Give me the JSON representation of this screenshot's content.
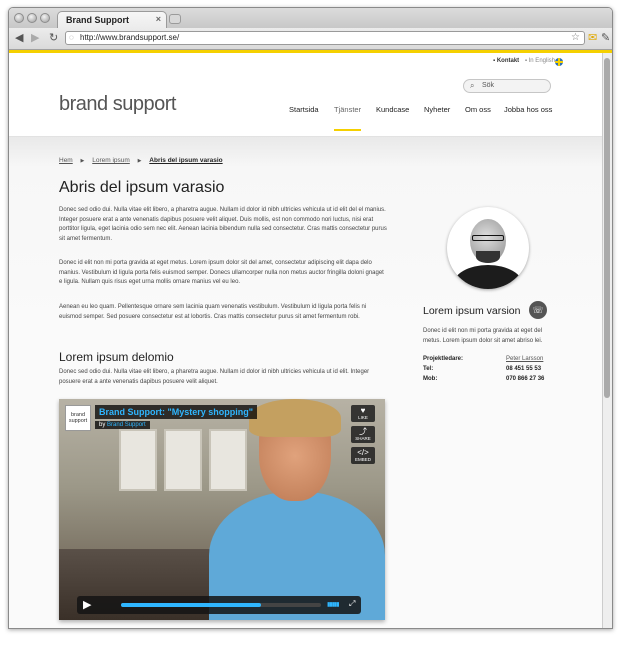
{
  "browser": {
    "tab_title": "Brand Support",
    "tab_close": "×",
    "url": "http://www.brandsupport.se/",
    "back_glyph": "◀",
    "forward_glyph": "▶",
    "icons": [
      "back-arrow-icon",
      "forward-arrow-icon",
      "page-icon",
      "star-icon",
      "mail-icon",
      "wrench-icon"
    ]
  },
  "header": {
    "contact_link": "Kontakt",
    "english_link": "In English",
    "search_placeholder": "Sök",
    "logo": "brand support",
    "nav": [
      "Startsida",
      "Tjänster",
      "Kundcase",
      "Nyheter",
      "Om oss",
      "Jobba hos oss"
    ],
    "active_nav": "Tjänster"
  },
  "breadcrumb": [
    "Hem",
    "Lorem ipsum",
    "Abris del ipsum varasio"
  ],
  "main": {
    "title": "Abris del ipsum varasio",
    "paragraphs": [
      "Donec sed odio dui. Nulla vitae elit libero, a pharetra augue. Nullam id dolor id nibh ultricies vehicula ut id elit del el manius. Integer posuere erat a ante venenatis dapibus posuere velit aliquet. Duis mollis, est non commodo nori luctus, nisi erat porttitor ligula, eget lacinia odio sem nec elit. Aenean lacinia bibendum nulla sed consectetur. Cras mattis consectetur purus sit amet fermentum.",
      "Donec id elit non mi porta gravida at eget metus. Lorem ipsum dolor sit del amet, consectetur adipiscing elit dapa delo manius. Vestibulum id ligula porta felis euismod semper. Donecs ullamcorper nulla non metus auctor fringilla doloni gnaget e ligula. Nullam quis risus eget urna mollis ornare manius vel eu leo.",
      "Aenean eu leo quam. Pellentesque ornare sem lacinia quam venenatis vestibulum. Vestibulum id ligula porta felis ni euismod semper. Sed posuere consectetur est at lobortis. Cras mattis consectetur purus sit amet fermentum robi."
    ],
    "subtitle": "Lorem ipsum delomio",
    "sub_paragraph": "Donec sed odio dui. Nulla vitae elit libero, a pharetra augue. Nullam id dolor id nibh ultricies vehicula ut id elit. Integer posuere erat a ante venenatis dapibus posuere velit aliquet."
  },
  "video": {
    "logo_text": "brand support",
    "title": "Brand Support: \"Mystery shopping\"",
    "by_label": "by",
    "by_name": "Brand Support",
    "like": "LIKE",
    "share": "SHARE",
    "embed": "EMBED",
    "progress": 0.7
  },
  "sidebar": {
    "title": "Lorem ipsum varsion",
    "text": "Donec id elit non mi porta gravida at eget del metus. Lorem ipsum dolor sit amet abriso lei.",
    "contact": [
      {
        "label": "Projektledare:",
        "value": "Peter Larsson"
      },
      {
        "label": "Tel:",
        "value": "08 451 55 53"
      },
      {
        "label": "Mob:",
        "value": "070 866 27 36"
      }
    ]
  },
  "colors": {
    "accent": "#f5d000",
    "video_blue": "#2fb6ff"
  }
}
